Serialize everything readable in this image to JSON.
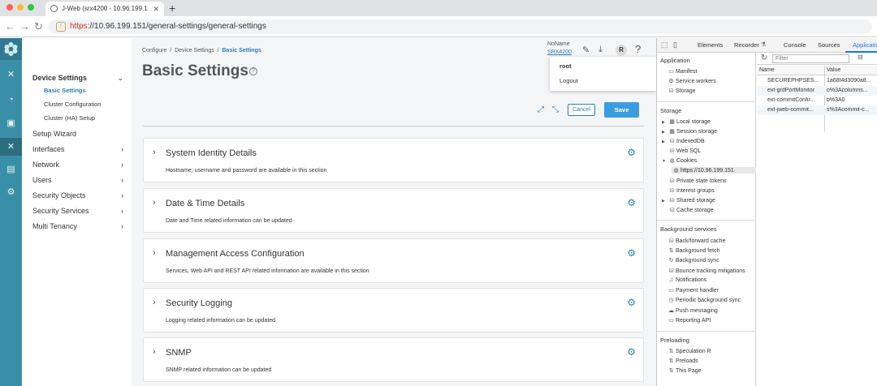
{
  "browser": {
    "tab_title": "J-Web (srx4200 - 10.96.199.1",
    "url_scheme": "https",
    "url_rest": "://10.96.199.151/general-settings/general-settings"
  },
  "nav": {
    "device_settings": "Device Settings",
    "basic_settings": "Basic Settings",
    "cluster_configuration": "Cluster Configuration",
    "cluster_ha_setup": "Cluster (HA) Setup",
    "setup_wizard": "Setup Wizard",
    "interfaces": "Interfaces",
    "network": "Network",
    "users": "Users",
    "security_objects": "Security Objects",
    "security_services": "Security Services",
    "multi_tenancy": "Multi Tenancy"
  },
  "header": {
    "breadcrumb": [
      "Configure",
      "Device Settings",
      "Basic Settings"
    ],
    "title": "Basic Settings",
    "host_name": "NoName",
    "model": "SRX4200",
    "avatar_letter": "R",
    "help_q": "?",
    "menu_user": "root",
    "menu_logout": "Logout",
    "cancel": "Cancel",
    "save": "Save"
  },
  "sections": [
    {
      "title": "System Identity Details",
      "desc": "Hostname, username and password are available in this section"
    },
    {
      "title": "Date & Time Details",
      "desc": "Date and Time related information can be updated"
    },
    {
      "title": "Management Access Configuration",
      "desc": "Services, Web API and REST API related information are available in this section"
    },
    {
      "title": "Security Logging",
      "desc": "Logging related information can be updated"
    },
    {
      "title": "SNMP",
      "desc": "SNMP related information can be updated"
    }
  ],
  "devtools": {
    "tabs": [
      "Elements",
      "Recorder",
      "Console",
      "Sources",
      "Application"
    ],
    "application_label": "Application",
    "manifest": "Manifest",
    "service_workers": "Service workers",
    "storage_item": "Storage",
    "storage_label": "Storage",
    "local_storage": "Local storage",
    "session_storage": "Session storage",
    "indexeddb": "IndexedDB",
    "web_sql": "Web SQL",
    "cookies": "Cookies",
    "cookie_origin": "https://10.96.199.151",
    "private_state_tokens": "Private state tokens",
    "interest_groups": "Interest groups",
    "shared_storage": "Shared storage",
    "cache_storage": "Cache storage",
    "background_label": "Background services",
    "back_forward_cache": "Back/forward cache",
    "background_fetch": "Background fetch",
    "background_sync": "Background sync",
    "bounce_tracking": "Bounce tracking mitigations",
    "notifications": "Notifications",
    "payment_handler": "Payment handler",
    "periodic_sync": "Periodic background sync",
    "push_messaging": "Push messaging",
    "reporting_api": "Reporting API",
    "preloading_label": "Preloading",
    "speculation_rules": "Speculation R",
    "preloads": "Preloads",
    "this_page": "This Page",
    "filter_placeholder": "Filter",
    "col_name": "Name",
    "col_value": "Value",
    "cookies_rows": [
      {
        "name": "SECUREPHPSES...",
        "value": "1a68f4d3090a8..."
      },
      {
        "name": "ext-grdPortMonitor",
        "value": "o%3Acolumns..."
      },
      {
        "name": "ext-commitConfir...",
        "value": "b%3A0"
      },
      {
        "name": "ext-jweb-commit...",
        "value": "s%3Acommit-c..."
      }
    ]
  },
  "colors": {
    "rail": "#3a8fa8",
    "accent": "#2b7fb0",
    "save": "#3b9de0"
  }
}
